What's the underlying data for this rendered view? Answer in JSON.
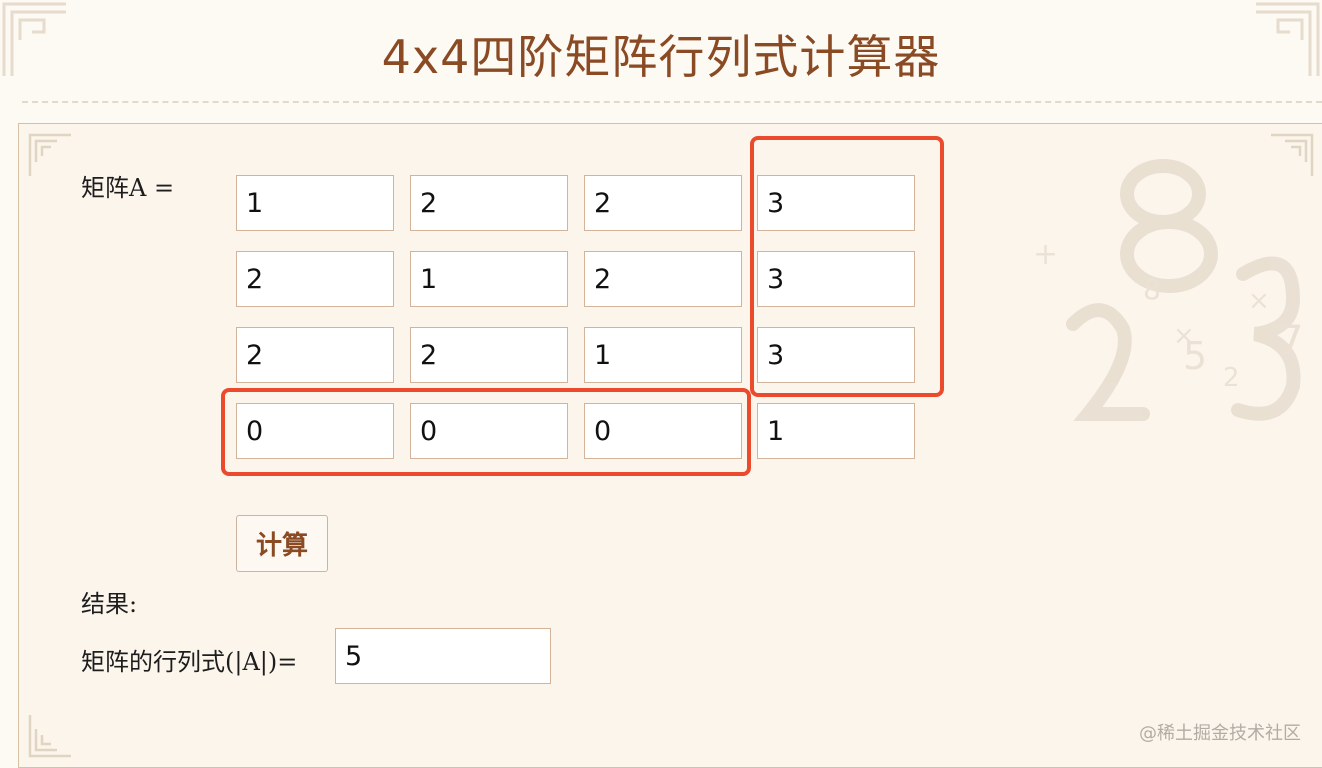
{
  "page": {
    "title": "4x4四阶矩阵行列式计算器"
  },
  "form": {
    "matrix_label": "矩阵A =",
    "matrix": [
      [
        "1",
        "2",
        "2",
        "3"
      ],
      [
        "2",
        "1",
        "2",
        "3"
      ],
      [
        "2",
        "2",
        "1",
        "3"
      ],
      [
        "0",
        "0",
        "0",
        "1"
      ]
    ],
    "calculate_label": "计算",
    "result_label": "结果:",
    "determinant_label": "矩阵的行列式(|A|)=",
    "determinant_value": "5"
  },
  "annotations": {
    "highlight_color": "#ec4a2c",
    "highlighted": [
      "column-4-rows-1-3",
      "row-4-columns-1-3"
    ]
  },
  "watermark": "@稀土掘金技术社区",
  "colors": {
    "title": "#8a4a24",
    "background": "#fdf9f3",
    "panel": "#fcf5ec",
    "input_border": "#d3b39a"
  }
}
